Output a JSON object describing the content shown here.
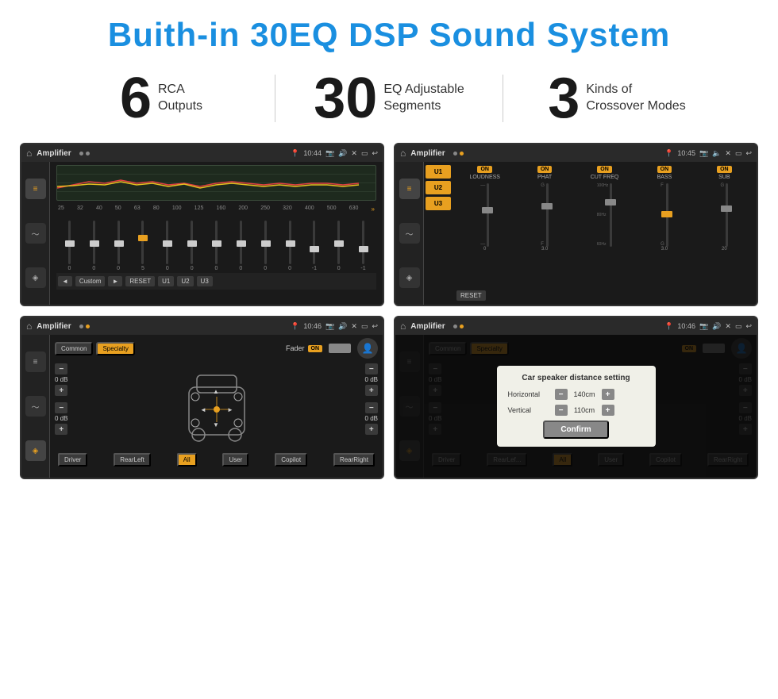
{
  "page": {
    "title": "Buith-in 30EQ DSP Sound System"
  },
  "stats": [
    {
      "number": "6",
      "text_line1": "RCA",
      "text_line2": "Outputs"
    },
    {
      "number": "30",
      "text_line1": "EQ Adjustable",
      "text_line2": "Segments"
    },
    {
      "number": "3",
      "text_line1": "Kinds of",
      "text_line2": "Crossover Modes"
    }
  ],
  "screen1": {
    "title": "Amplifier",
    "time": "10:44",
    "freq_labels": [
      "25",
      "32",
      "40",
      "50",
      "63",
      "80",
      "100",
      "125",
      "160",
      "200",
      "250",
      "320",
      "400",
      "500",
      "630"
    ],
    "slider_values": [
      "0",
      "0",
      "0",
      "5",
      "0",
      "0",
      "0",
      "0",
      "0",
      "0",
      "-1",
      "0",
      "-1"
    ],
    "bottom_buttons": [
      "◄",
      "Custom",
      "►",
      "RESET",
      "U1",
      "U2",
      "U3"
    ]
  },
  "screen2": {
    "title": "Amplifier",
    "time": "10:45",
    "presets": [
      "U1",
      "U2",
      "U3"
    ],
    "channels": [
      {
        "on": true,
        "label": "LOUDNESS"
      },
      {
        "on": true,
        "label": "PHAT"
      },
      {
        "on": true,
        "label": "CUT FREQ"
      },
      {
        "on": true,
        "label": "BASS"
      },
      {
        "on": true,
        "label": "SUB"
      }
    ],
    "reset_btn": "RESET"
  },
  "screen3": {
    "title": "Amplifier",
    "time": "10:46",
    "tabs": [
      "Common",
      "Specialty"
    ],
    "fader_label": "Fader",
    "on_label": "ON",
    "vol_controls": [
      {
        "val": "0 dB"
      },
      {
        "val": "0 dB"
      },
      {
        "val": "0 dB"
      },
      {
        "val": "0 dB"
      }
    ],
    "bottom_buttons": [
      "Driver",
      "RearLeft",
      "All",
      "User",
      "Copilot",
      "RearRight"
    ]
  },
  "screen4": {
    "title": "Amplifier",
    "time": "10:46",
    "tabs": [
      "Common",
      "Specialty"
    ],
    "on_label": "ON",
    "dialog": {
      "title": "Car speaker distance setting",
      "horizontal_label": "Horizontal",
      "horizontal_value": "140cm",
      "vertical_label": "Vertical",
      "vertical_value": "110cm",
      "confirm_label": "Confirm"
    },
    "bottom_buttons": [
      "Driver",
      "RearLef...",
      "All",
      "User",
      "Copilot",
      "RearRight"
    ]
  }
}
